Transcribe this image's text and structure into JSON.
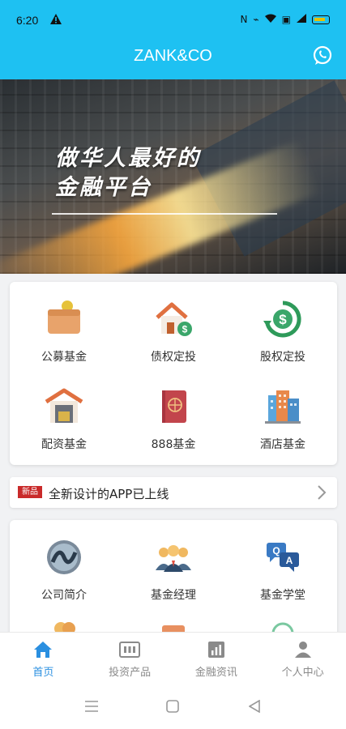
{
  "status": {
    "time": "6:20"
  },
  "app": {
    "title": "ZANK&CO"
  },
  "banner": {
    "slogan_line1": "做华人最好的",
    "slogan_line2": "金融平台"
  },
  "products": [
    {
      "label": "公募基金",
      "icon": "wallet-icon"
    },
    {
      "label": "债权定投",
      "icon": "house-dollar-icon"
    },
    {
      "label": "股权定投",
      "icon": "dollar-refresh-icon"
    },
    {
      "label": "配资基金",
      "icon": "warehouse-icon"
    },
    {
      "label": "888基金",
      "icon": "passport-icon"
    },
    {
      "label": "酒店基金",
      "icon": "hotel-icon"
    }
  ],
  "notice": {
    "tag": "新品",
    "text": "全新设计的APP已上线"
  },
  "services": [
    {
      "label": "公司简介",
      "icon": "globe-icon"
    },
    {
      "label": "基金经理",
      "icon": "managers-icon"
    },
    {
      "label": "基金学堂",
      "icon": "qa-icon"
    }
  ],
  "tabs": [
    {
      "label": "首页",
      "icon": "home-icon",
      "active": true
    },
    {
      "label": "投资产品",
      "icon": "products-icon",
      "active": false
    },
    {
      "label": "金融资讯",
      "icon": "chart-icon",
      "active": false
    },
    {
      "label": "个人中心",
      "icon": "person-icon",
      "active": false
    }
  ],
  "colors": {
    "primary": "#1ec1f2",
    "tab_active": "#2a8fe0"
  }
}
